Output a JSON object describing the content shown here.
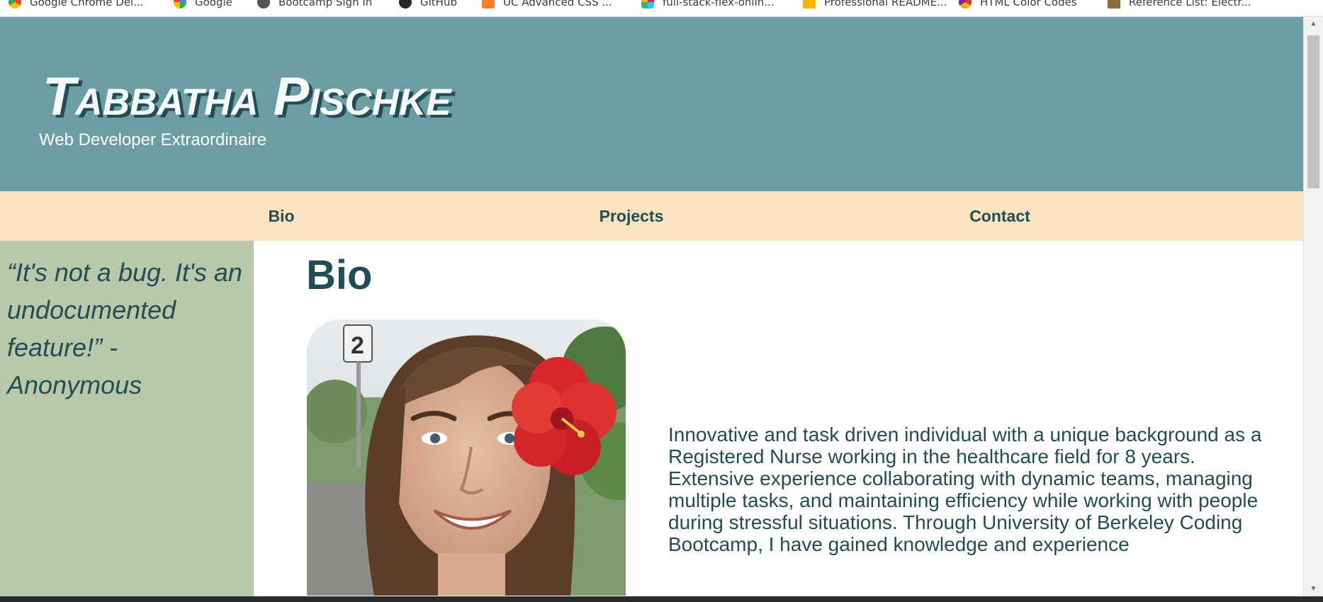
{
  "bookmarks": [
    {
      "label": "Google Chrome Del...",
      "icon": "chrome-icon",
      "color": "#4caf50"
    },
    {
      "label": "Google",
      "icon": "google-icon",
      "color": "#34a853"
    },
    {
      "label": "Bootcamp Sign In",
      "icon": "bootcamp-icon",
      "color": "#444444"
    },
    {
      "label": "GitHub",
      "icon": "github-icon",
      "color": "#24292e"
    },
    {
      "label": "UC Advanced CSS ...",
      "icon": "stackoverflow-icon",
      "color": "#f48024"
    },
    {
      "label": "full-stack-flex-onlin...",
      "icon": "slack-icon",
      "color": "#e01e5a"
    },
    {
      "label": "Professional README...",
      "icon": "bookmark-icon",
      "color": "#f4b400"
    },
    {
      "label": "HTML Color Codes",
      "icon": "color-wheel-icon",
      "color": "#d93025"
    },
    {
      "label": "Reference List: Electr...",
      "icon": "document-icon",
      "color": "#8a6d3b"
    }
  ],
  "header": {
    "name": "Tabbatha Pischke",
    "tagline": "Web Developer Extraordinaire"
  },
  "nav": {
    "items": [
      "Bio",
      "Projects",
      "Contact"
    ]
  },
  "aside": {
    "quote": "“It's not a bug. It's an undocumented feature!” - Anonymous"
  },
  "bio": {
    "title": "Bio",
    "text": "Innovative and task driven individual with a unique background as a Registered Nurse working in the healthcare field for 8 years. Extensive experience collaborating with dynamic teams, managing multiple tasks, and maintaining efficiency while working with people during stressful situations. Through University of Berkeley Coding Bootcamp, I have gained knowledge and experience"
  },
  "colors": {
    "header_bg": "#6b9ea3",
    "nav_bg": "#fbe3bf",
    "aside_bg": "#b8c9ab",
    "text_dark": "#234d54"
  }
}
